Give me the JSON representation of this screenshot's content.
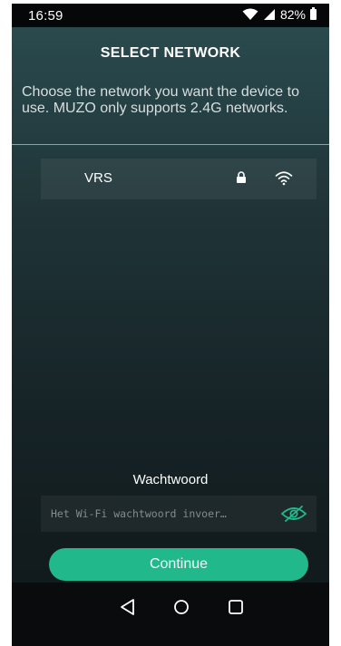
{
  "status_bar": {
    "time": "16:59",
    "battery": "82%"
  },
  "header": {
    "title": "SELECT NETWORK"
  },
  "intro": {
    "text": "Choose the network you want the device to use. MUZO only supports 2.4G networks."
  },
  "networks": [
    {
      "name": "VRS",
      "secured": true,
      "icon_lock": "lock-icon",
      "icon_signal": "wifi-icon"
    }
  ],
  "password": {
    "label": "Wachtwoord",
    "placeholder": "Het Wi-Fi wachtwoord invoer…",
    "value": ""
  },
  "actions": {
    "continue_label": "Continue"
  },
  "colors": {
    "accent": "#21b98c",
    "background_top": "#2a4a4e",
    "background_bottom": "#111a1c"
  },
  "nav": {
    "icons": [
      "back-icon",
      "home-icon",
      "recent-apps-icon"
    ]
  }
}
